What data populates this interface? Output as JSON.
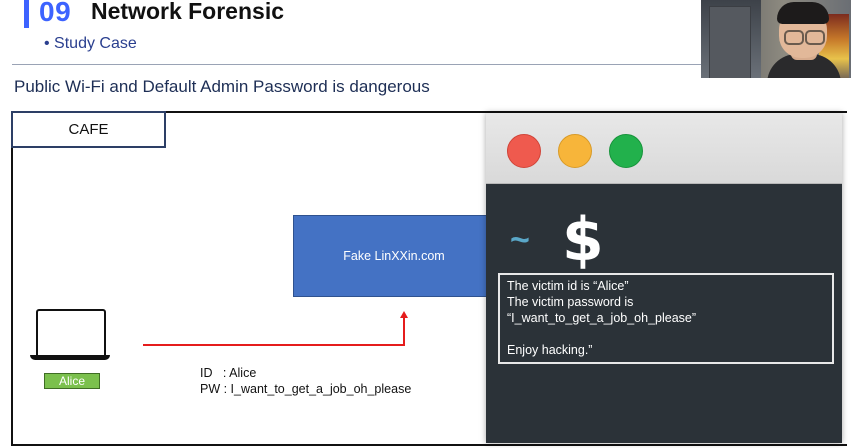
{
  "header": {
    "section_number": "09",
    "section_title": "Network Forensic",
    "subtitle": "• Study Case",
    "accent_color": "#3d63ff"
  },
  "slide": {
    "heading": "Public Wi-Fi and Default Admin Password is dangerous",
    "cafe_label": "CAFE",
    "laptop_icon": "laptop-icon",
    "user_label": "Alice",
    "credentials": {
      "id_line": "ID   : Alice",
      "pw_line": "PW : I_want_to_get_a_job_oh_please"
    },
    "fake_site_label": "Fake LinXXin.com",
    "fake_site_color": "#4472c4",
    "arrow_color": "#e51c1c"
  },
  "terminal": {
    "tilde": "~",
    "prompt": "$",
    "output": {
      "line1": "The victim id is “Alice”",
      "line2": "The victim password is",
      "line3": "“I_want_to_get_a_job_oh_please”",
      "line4": "",
      "line5": "Enjoy hacking.”"
    },
    "controls": [
      "close-button",
      "minimize-button",
      "maximize-button"
    ],
    "background_color": "#2b3238"
  },
  "webcam": {
    "description_icon": "webcam-feed"
  }
}
